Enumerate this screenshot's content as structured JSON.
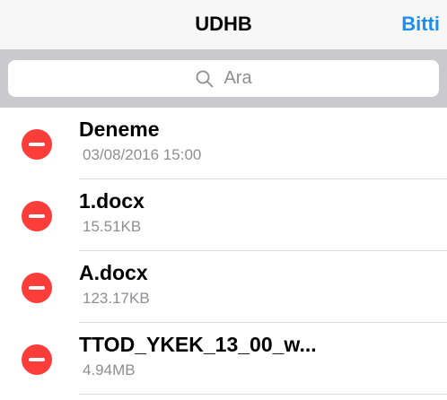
{
  "navbar": {
    "title": "UDHB",
    "done_label": "Bitti"
  },
  "search": {
    "placeholder": "Ara",
    "icon": "search-icon"
  },
  "items": [
    {
      "title": "Deneme",
      "subtitle": "03/08/2016 15:00"
    },
    {
      "title": "1.docx",
      "subtitle": "15.51KB"
    },
    {
      "title": "A.docx",
      "subtitle": "123.17KB"
    },
    {
      "title": "TTOD_YKEK_13_00_w...",
      "subtitle": "4.94MB"
    }
  ],
  "colors": {
    "accent": "#1b8ff0",
    "delete": "#fc3d39",
    "navbar_bg": "#f7f7f7",
    "search_bar_bg": "#c9c9ce",
    "secondary_text": "#8e8e93"
  }
}
